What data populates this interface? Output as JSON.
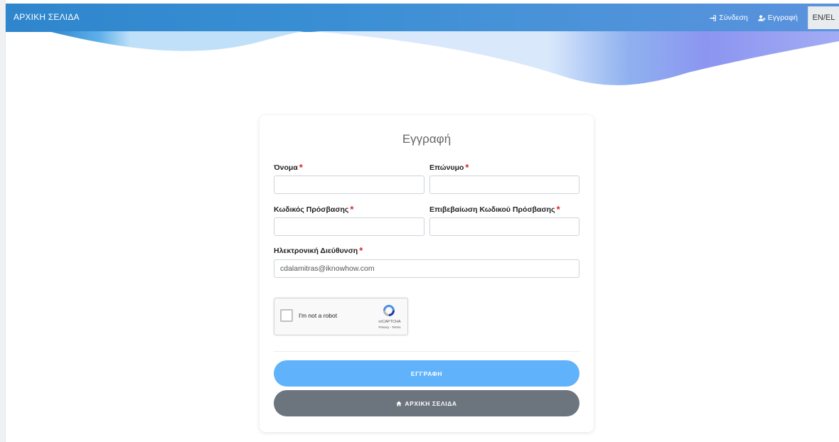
{
  "header": {
    "brand": "ΑΡΧΙΚΗ ΣΕΛΙΔΑ",
    "login_label": "Σύνδεση",
    "register_label": "Εγγραφή",
    "lang_label": "EN/EL",
    "login_icon": "sign-in-icon",
    "register_icon": "user-plus-icon"
  },
  "form": {
    "title": "Εγγραφή",
    "required_mark": "*",
    "fields": {
      "first_name": {
        "label": "Όνομα",
        "value": ""
      },
      "last_name": {
        "label": "Επώνυμο",
        "value": ""
      },
      "password": {
        "label": "Κωδικός Πρόσβασης",
        "value": ""
      },
      "password_confirm": {
        "label": "Επιβεβαίωση Κωδικού Πρόσβασης",
        "value": ""
      },
      "email": {
        "label": "Ηλεκτρονική Διεύθυνση",
        "value": "cdalamitras@iknowhow.com"
      }
    },
    "captcha": {
      "label": "I'm not a robot",
      "brand": "reCAPTCHA",
      "links": "Privacy - Terms",
      "icon": "recaptcha-icon"
    },
    "submit_label": "ΕΓΓΡΑΦΗ",
    "home_label": "ΑΡΧΙΚΗ ΣΕΛΙΔΑ",
    "home_icon": "home-icon"
  },
  "colors": {
    "header": "#3a8fd4",
    "required": "#e02424",
    "primary_button": "#60b3fb",
    "secondary_button": "#6c757d"
  }
}
